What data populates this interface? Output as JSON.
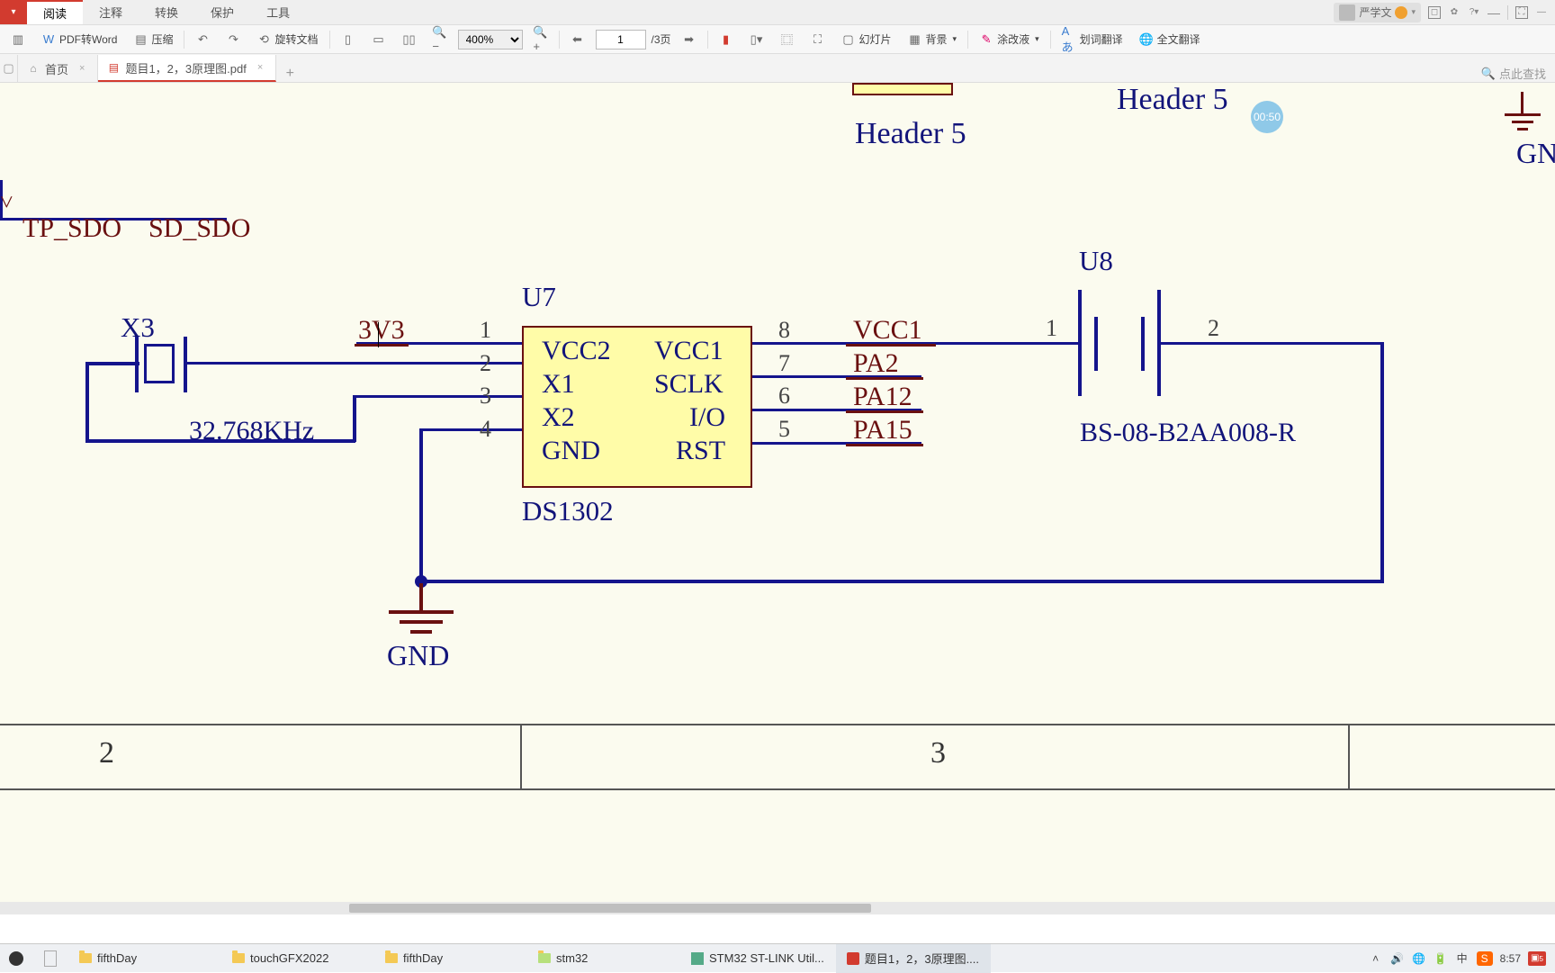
{
  "menu": {
    "items": [
      "阅读",
      "注释",
      "转换",
      "保护",
      "工具"
    ],
    "active": 0,
    "user": "严学文"
  },
  "toolbar": {
    "pdf2word": "PDF转Word",
    "compress": "压缩",
    "rotate": "旋转文档",
    "zoom": "400%",
    "page": "1",
    "pages": "/3页",
    "slide": "幻灯片",
    "bg": "背景",
    "erase": "涂改液",
    "word_trans": "划词翻译",
    "full_trans": "全文翻译"
  },
  "tabs": {
    "home": "首页",
    "doc": "题目1，2，3原理图.pdf",
    "search": "点此查找"
  },
  "badge": "00:50",
  "sch": {
    "header5": "Header 5",
    "header5b": "Header 5",
    "gn": "GN",
    "tp_sdo": "TP_SDO",
    "sd_sdo": "SD_SDO",
    "x3": "X3",
    "xtal": "32.768KHz",
    "u7": "U7",
    "chip": "DS1302",
    "vcc2": "VCC2",
    "vcc1": "VCC1",
    "x1": "X1",
    "sclk": "SCLK",
    "x2": "X2",
    "io": "I/O",
    "gndp": "GND",
    "rst": "RST",
    "p1": "1",
    "p2": "2",
    "p3": "3",
    "p4": "4",
    "p5": "5",
    "p6": "6",
    "p7": "7",
    "p8": "8",
    "net3v3": "3V3",
    "netvcc1": "VCC1",
    "pa2": "PA2",
    "pa12": "PA12",
    "pa15": "PA15",
    "u8": "U8",
    "u8p1": "1",
    "u8p2": "2",
    "bs": "BS-08-B2AA008-R",
    "gnd": "GND",
    "col2": "2",
    "col3": "3"
  },
  "taskbar": {
    "items": [
      "fifthDay",
      "touchGFX2022",
      "fifthDay",
      "stm32",
      "STM32 ST-LINK Util...",
      "题目1，2，3原理图...."
    ],
    "clock": "8:57",
    "notif": "5"
  }
}
